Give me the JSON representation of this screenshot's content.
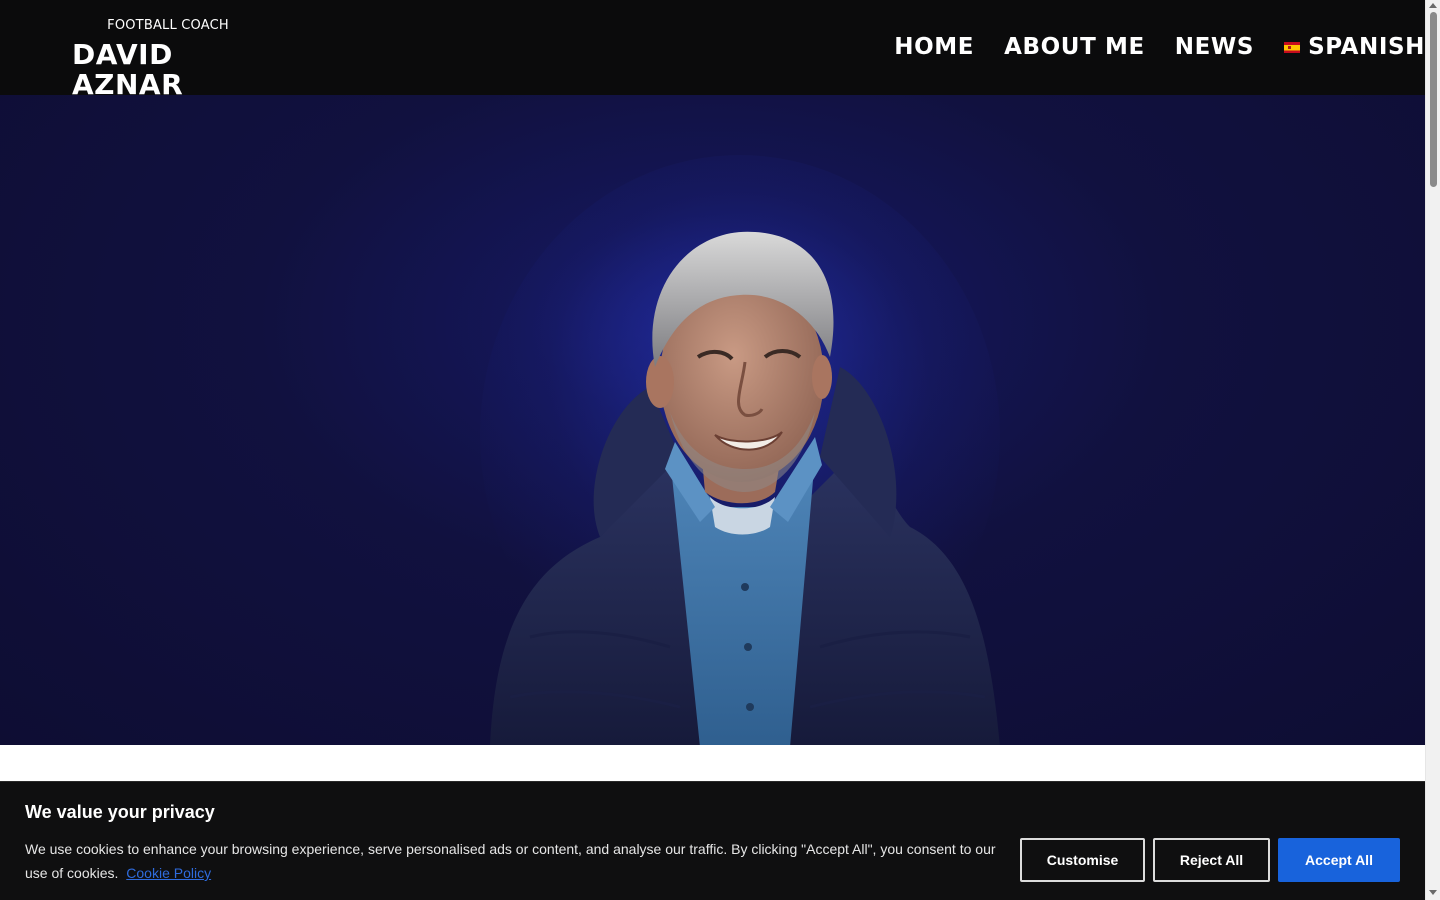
{
  "header": {
    "subtitle": "FOOTBALL COACH",
    "title": "DAVID AZNAR",
    "background_color": "#0b0b0c"
  },
  "nav": {
    "items": [
      {
        "label": "HOME"
      },
      {
        "label": "ABOUT ME"
      },
      {
        "label": "NEWS"
      },
      {
        "label": "SPANISH",
        "icon": "spain-flag-icon"
      }
    ]
  },
  "hero": {
    "background_color": "#11113f",
    "image": "coach-portrait"
  },
  "cookie_banner": {
    "title": "We value your privacy",
    "text": "We use cookies to enhance your browsing experience, serve personalised ads or content, and analyse our traffic. By clicking \"Accept All\", you consent to our use of cookies.",
    "link_label": "Cookie Policy",
    "buttons": {
      "customise": "Customise",
      "reject": "Reject All",
      "accept": "Accept All"
    },
    "accent_color": "#1863dc"
  }
}
